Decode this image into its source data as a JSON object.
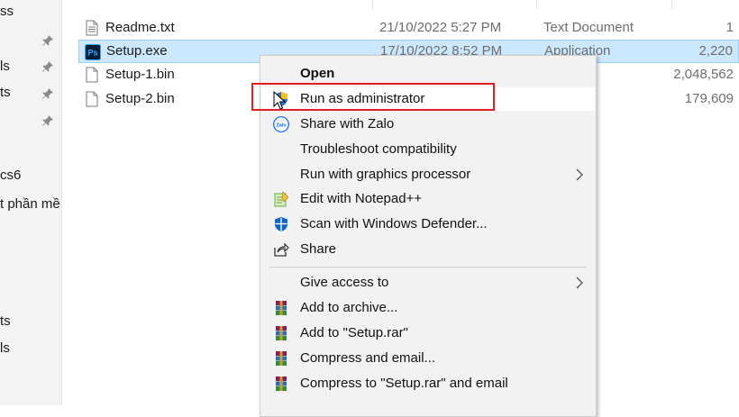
{
  "nav": {
    "items": [
      {
        "label": "ss",
        "pinned": false
      },
      {
        "label": "",
        "pinned": true
      },
      {
        "label": "ls",
        "pinned": true
      },
      {
        "label": "ts",
        "pinned": true
      },
      {
        "label": "",
        "pinned": true
      },
      {
        "label": "cs6",
        "pinned": false
      },
      {
        "label": "t phần mề",
        "pinned": false
      },
      {
        "label": "ts",
        "pinned": false
      },
      {
        "label": "ls",
        "pinned": false
      }
    ]
  },
  "files": [
    {
      "name": "Readme.txt",
      "date": "21/10/2022 5:27 PM",
      "type": "Text Document",
      "size": "1",
      "icon": "text-file-icon"
    },
    {
      "name": "Setup.exe",
      "date": "17/10/2022 8:52 PM",
      "type": "Application",
      "size": "2,220",
      "icon": "photoshop-icon"
    },
    {
      "name": "Setup-1.bin",
      "date": "",
      "type": "",
      "size": "2,048,562",
      "icon": "blank-file-icon"
    },
    {
      "name": "Setup-2.bin",
      "date": "",
      "type": "",
      "size": "179,609",
      "icon": "blank-file-icon"
    }
  ],
  "context_menu": {
    "items": [
      {
        "label": "Open",
        "icon": "",
        "bold": true
      },
      {
        "label": "Run as administrator",
        "icon": "uac-shield-icon",
        "highlighted": true
      },
      {
        "label": "Share with Zalo",
        "icon": "zalo-icon"
      },
      {
        "label": "Troubleshoot compatibility",
        "icon": ""
      },
      {
        "label": "Run with graphics processor",
        "icon": "",
        "submenu": true
      },
      {
        "label": "Edit with Notepad++",
        "icon": "notepad-plus-plus-icon"
      },
      {
        "label": "Scan with Windows Defender...",
        "icon": "windows-defender-icon"
      },
      {
        "label": "Share",
        "icon": "share-icon"
      },
      {
        "label": "Give access to",
        "icon": "",
        "submenu": true
      },
      {
        "label": "Add to archive...",
        "icon": "winrar-icon"
      },
      {
        "label": "Add to \"Setup.rar\"",
        "icon": "winrar-icon"
      },
      {
        "label": "Compress and email...",
        "icon": "winrar-icon"
      },
      {
        "label": "Compress to \"Setup.rar\" and email",
        "icon": "winrar-icon"
      }
    ]
  },
  "colors": {
    "selection_bg": "#cce8ff",
    "annotation_red": "#e02020"
  }
}
